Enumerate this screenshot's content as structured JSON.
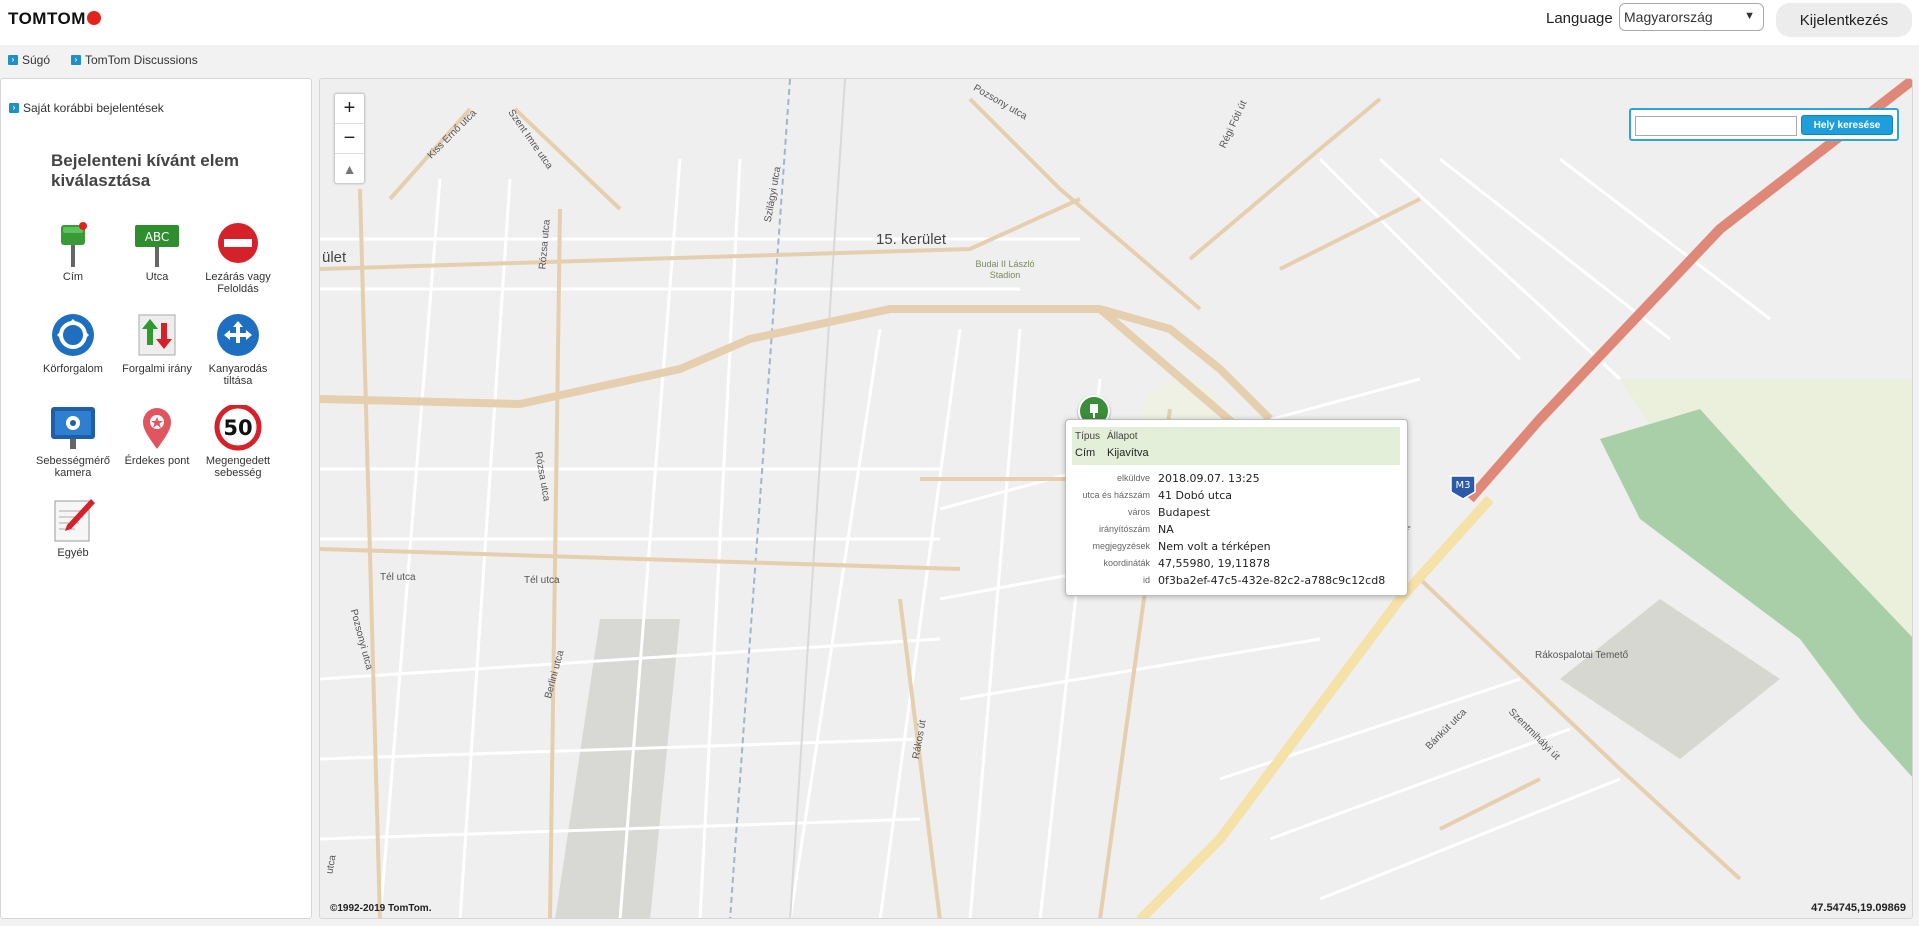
{
  "header": {
    "logo_text": "TOMTOM",
    "language_label": "Language",
    "language_selected": "Magyarország",
    "logout_label": "Kijelentkezés"
  },
  "nav": {
    "help": "Súgó",
    "discussions": "TomTom Discussions"
  },
  "sidebar": {
    "previous_reports": "Saját korábbi bejelentések",
    "heading": "Bejelenteni kívánt elem kiválasztása",
    "tiles": [
      {
        "label": "Cím",
        "icon": "address-sign-icon"
      },
      {
        "label": "Utca",
        "icon": "street-sign-icon"
      },
      {
        "label": "Lezárás vagy Feloldás",
        "icon": "no-entry-icon"
      },
      {
        "label": "Körforgalom",
        "icon": "roundabout-icon"
      },
      {
        "label": "Forgalmi irány",
        "icon": "traffic-direction-icon"
      },
      {
        "label": "Kanyarodás tiltása",
        "icon": "turn-restriction-icon"
      },
      {
        "label": "Sebességmérő kamera",
        "icon": "speed-camera-icon"
      },
      {
        "label": "Érdekes pont",
        "icon": "poi-pin-icon"
      },
      {
        "label": "Megengedett sebesség",
        "icon": "speed-limit-icon"
      },
      {
        "label": "Egyéb",
        "icon": "other-edit-icon"
      }
    ],
    "speed_limit_value": "50",
    "street_sign_text": "ABC"
  },
  "map": {
    "zoom_in": "+",
    "zoom_out": "−",
    "compass": "▲",
    "search_placeholder": "",
    "search_button": "Hely keresése",
    "labels": {
      "district_15": "15. kerület",
      "district_left": "ület",
      "stadium": "Budai II László Stadion",
      "pozsony_top": "Pozsony utca",
      "kiss_erno": "Kiss Ernő utca",
      "szent_imre": "Szent Imre utca",
      "szilagyi": "Szilágyi utca",
      "regi_foti": "Régi Fóti út",
      "rozsa_1": "Rózsa utca",
      "rozsa_2": "Rózsa utca",
      "tel_1": "Tél utca",
      "tel_2": "Tél utca",
      "pozsonyi": "Pozsonyi utca",
      "berlini": "Berlini utca",
      "rakos": "Rákos út",
      "bankut": "Bánkút utca",
      "szentmihalyi": "Szentmihályi út",
      "temeto": "Rákospalotai Temető",
      "ut_frag": "út",
      "utca_frag": "utca"
    },
    "highway_shield": "M3",
    "copyright": "©1992-2019 TomTom.",
    "coordinates_readout": "47.54745,19.09869"
  },
  "popup": {
    "type_header": "Típus",
    "status_header": "Állapot",
    "type_value": "Cím",
    "status_value": "Kijavítva",
    "details": [
      {
        "label": "elküldve",
        "value": "2018.09.07. 13:25"
      },
      {
        "label": "utca és házszám",
        "value": "41 Dobó utca"
      },
      {
        "label": "város",
        "value": "Budapest"
      },
      {
        "label": "irányítószám",
        "value": "NA"
      },
      {
        "label": "megjegyzések",
        "value": "Nem volt a térképen"
      },
      {
        "label": "koordináták",
        "value": "47,55980, 19,11878"
      },
      {
        "label": "id",
        "value": "0f3ba2ef-47c5-432e-82c2-a788c9c12cd8"
      }
    ]
  },
  "colors": {
    "accent_blue": "#1e9fdc",
    "brand_red": "#e2231a",
    "motorway": "#e08878",
    "major_road": "#e6cfae",
    "primary_road": "#f5e2a8",
    "park_green": "#a9cfa9",
    "popup_header": "#e4efd9"
  }
}
